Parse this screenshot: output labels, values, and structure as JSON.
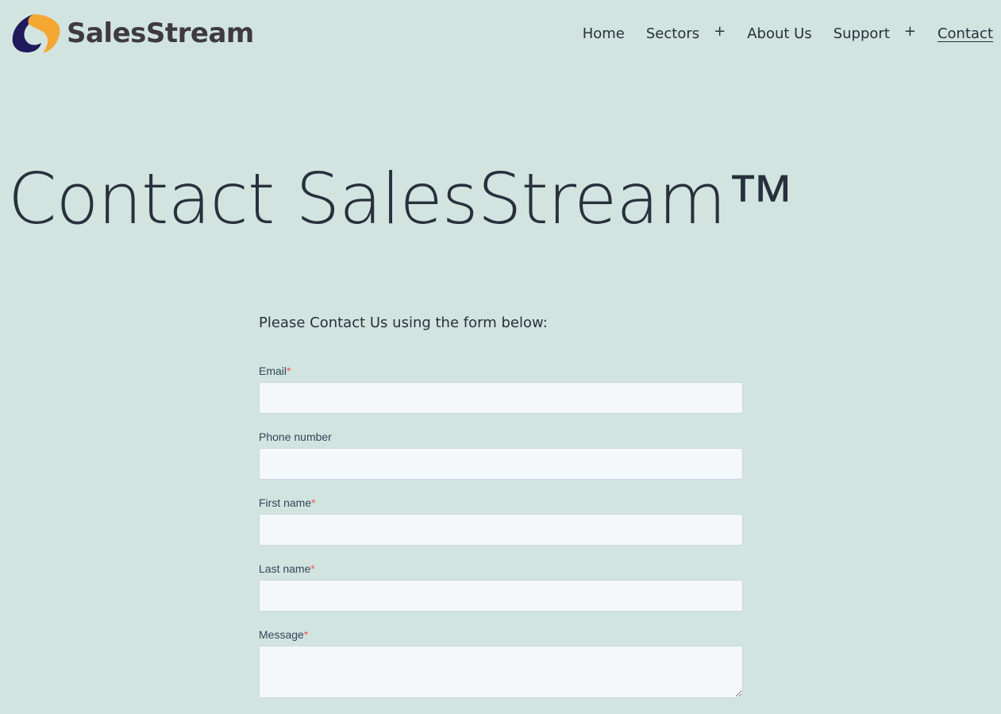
{
  "brand": {
    "name": "SalesStream",
    "colors": {
      "primary_dark": "#1f1a5c",
      "accent_orange": "#f5a733",
      "text": "#3f3942"
    }
  },
  "nav": {
    "items": [
      {
        "label": "Home",
        "has_submenu": false,
        "active": false
      },
      {
        "label": "Sectors",
        "has_submenu": true,
        "active": false
      },
      {
        "label": "About Us",
        "has_submenu": false,
        "active": false
      },
      {
        "label": "Support",
        "has_submenu": true,
        "active": false
      },
      {
        "label": "Contact",
        "has_submenu": false,
        "active": true
      }
    ],
    "submenu_icon": "+"
  },
  "page": {
    "title": "Contact SalesStream™",
    "background": "#d1e4df"
  },
  "form": {
    "intro": "Please Contact Us using the form below:",
    "required_marker": "*",
    "fields": {
      "email": {
        "label": "Email",
        "required": true,
        "value": ""
      },
      "phone": {
        "label": "Phone number",
        "required": false,
        "value": ""
      },
      "first_name": {
        "label": "First name",
        "required": true,
        "value": ""
      },
      "last_name": {
        "label": "Last name",
        "required": true,
        "value": ""
      },
      "message": {
        "label": "Message",
        "required": true,
        "value": ""
      }
    }
  }
}
